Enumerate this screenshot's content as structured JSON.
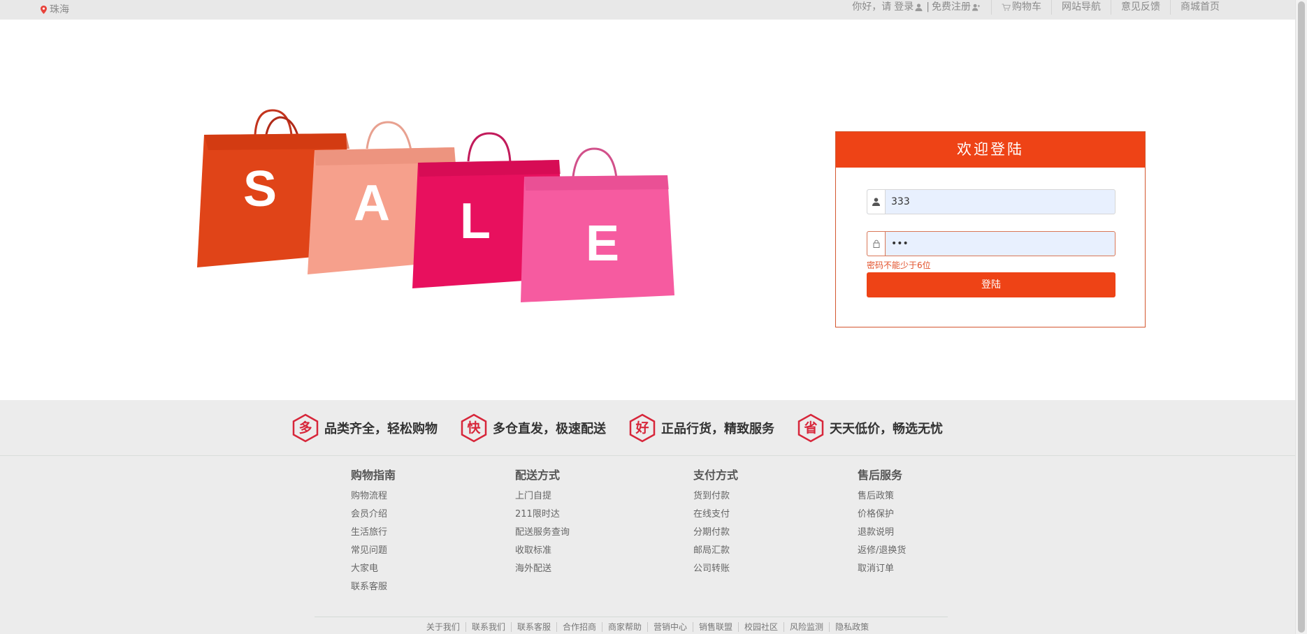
{
  "topbar": {
    "location": "珠海",
    "greeting": "你好，请",
    "login": "登录",
    "separator": "|",
    "register": "免费注册",
    "cart": "购物车",
    "nav": "网站导航",
    "feedback": "意见反馈",
    "home": "商城首页"
  },
  "hero": {
    "letters": [
      "S",
      "A",
      "L",
      "E"
    ]
  },
  "login": {
    "title": "欢迎登陆",
    "username_value": "333",
    "password_value": "•••",
    "error": "密码不能少于6位",
    "submit": "登陆"
  },
  "promises": [
    {
      "badge": "多",
      "text": "品类齐全，轻松购物"
    },
    {
      "badge": "快",
      "text": "多仓直发，极速配送"
    },
    {
      "badge": "好",
      "text": "正品行货，精致服务"
    },
    {
      "badge": "省",
      "text": "天天低价，畅选无忧"
    }
  ],
  "footer": {
    "columns": [
      {
        "title": "购物指南",
        "links": [
          "购物流程",
          "会员介绍",
          "生活旅行",
          "常见问题",
          "大家电",
          "联系客服"
        ]
      },
      {
        "title": "配送方式",
        "links": [
          "上门自提",
          "211限时达",
          "配送服务查询",
          "收取标准",
          "海外配送"
        ]
      },
      {
        "title": "支付方式",
        "links": [
          "货到付款",
          "在线支付",
          "分期付款",
          "邮局汇款",
          "公司转账"
        ]
      },
      {
        "title": "售后服务",
        "links": [
          "售后政策",
          "价格保护",
          "退款说明",
          "返修/退换货",
          "取消订单"
        ]
      }
    ],
    "bottom_links": [
      "关于我们",
      "联系我们",
      "联系客服",
      "合作招商",
      "商家帮助",
      "营销中心",
      "销售联盟",
      "校园社区",
      "风险监测",
      "隐私政策"
    ]
  },
  "colors": {
    "accent": "#ee4316",
    "badge": "#d7263a"
  }
}
